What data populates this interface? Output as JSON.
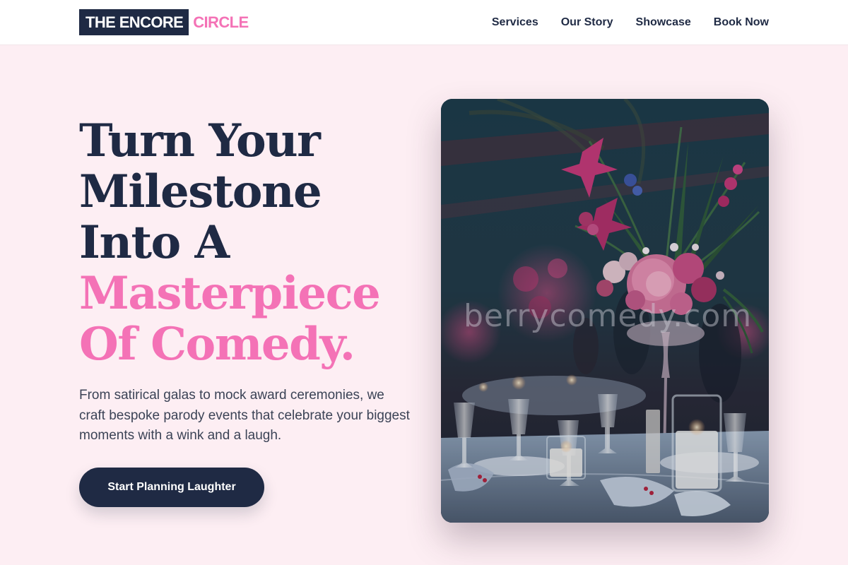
{
  "brand": {
    "name_main": "THE ENCORE",
    "name_accent": "CIRCLE"
  },
  "nav": {
    "items": [
      {
        "label": "Services"
      },
      {
        "label": "Our Story"
      },
      {
        "label": "Showcase"
      },
      {
        "label": "Book Now"
      }
    ]
  },
  "hero": {
    "title_lines": [
      "Turn Your",
      "Milestone",
      "Into A"
    ],
    "title_accent_lines": [
      "Masterpiece",
      "Of Comedy."
    ],
    "description": "From satirical galas to mock award ceremonies, we craft bespoke parody events that celebrate your biggest moments with a wink and a laugh.",
    "cta_label": "Start Planning Laughter"
  },
  "image": {
    "watermark": "berrycomedy.com"
  },
  "colors": {
    "navy": "#1f2a44",
    "pink_accent": "#f472b6",
    "page_background": "#fdeef3"
  }
}
